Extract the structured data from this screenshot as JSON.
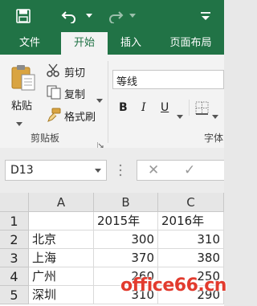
{
  "ribbon_tabs": [
    "文件",
    "开始",
    "插入",
    "页面布局"
  ],
  "clipboard": {
    "paste_label": "粘贴",
    "cut_label": "剪切",
    "copy_label": "复制",
    "format_painter_label": "格式刷",
    "group_title": "剪贴板"
  },
  "font": {
    "font_name": "等线",
    "bold": "B",
    "italic": "I",
    "underline": "U",
    "group_title": "字体"
  },
  "formula_bar": {
    "name_box": "D13",
    "cancel": "✕",
    "enter": "✓"
  },
  "sheet": {
    "columns": [
      "A",
      "B",
      "C"
    ],
    "rows": [
      {
        "num": "1",
        "a": "",
        "b": "2015年",
        "c": "2016年"
      },
      {
        "num": "2",
        "a": "北京",
        "b": "300",
        "c": "310"
      },
      {
        "num": "3",
        "a": "上海",
        "b": "370",
        "c": "380"
      },
      {
        "num": "4",
        "a": "广州",
        "b": "260",
        "c": "250"
      },
      {
        "num": "5",
        "a": "深圳",
        "b": "310",
        "c": "290"
      }
    ]
  },
  "watermark": "office66.cn",
  "colors": {
    "accent": "#217346",
    "watermark": "#e23b2e"
  }
}
